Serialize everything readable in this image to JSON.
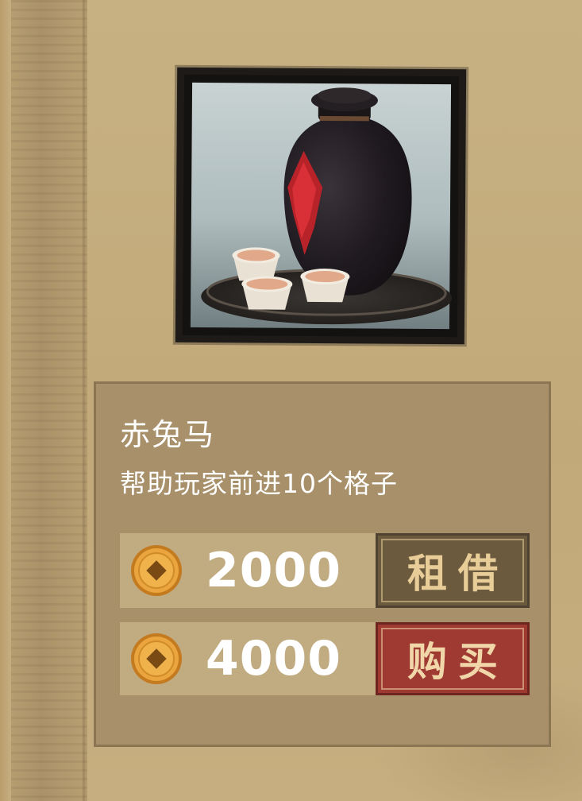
{
  "item": {
    "name": "赤兔马",
    "description": "帮助玩家前进10个格子",
    "image_icon": "wine-jar-with-cups-icon"
  },
  "rent": {
    "price": "2000",
    "currency_icon": "copper-coin-icon",
    "button_label": "租借"
  },
  "buy": {
    "price": "4000",
    "currency_icon": "copper-coin-icon",
    "button_label": "购买"
  },
  "colors": {
    "panel": "#a8906a",
    "price_row": "#c1ab80",
    "rent_button": "#6b5a3e",
    "buy_button": "#9f3a33",
    "coin": "#e6a23a"
  }
}
